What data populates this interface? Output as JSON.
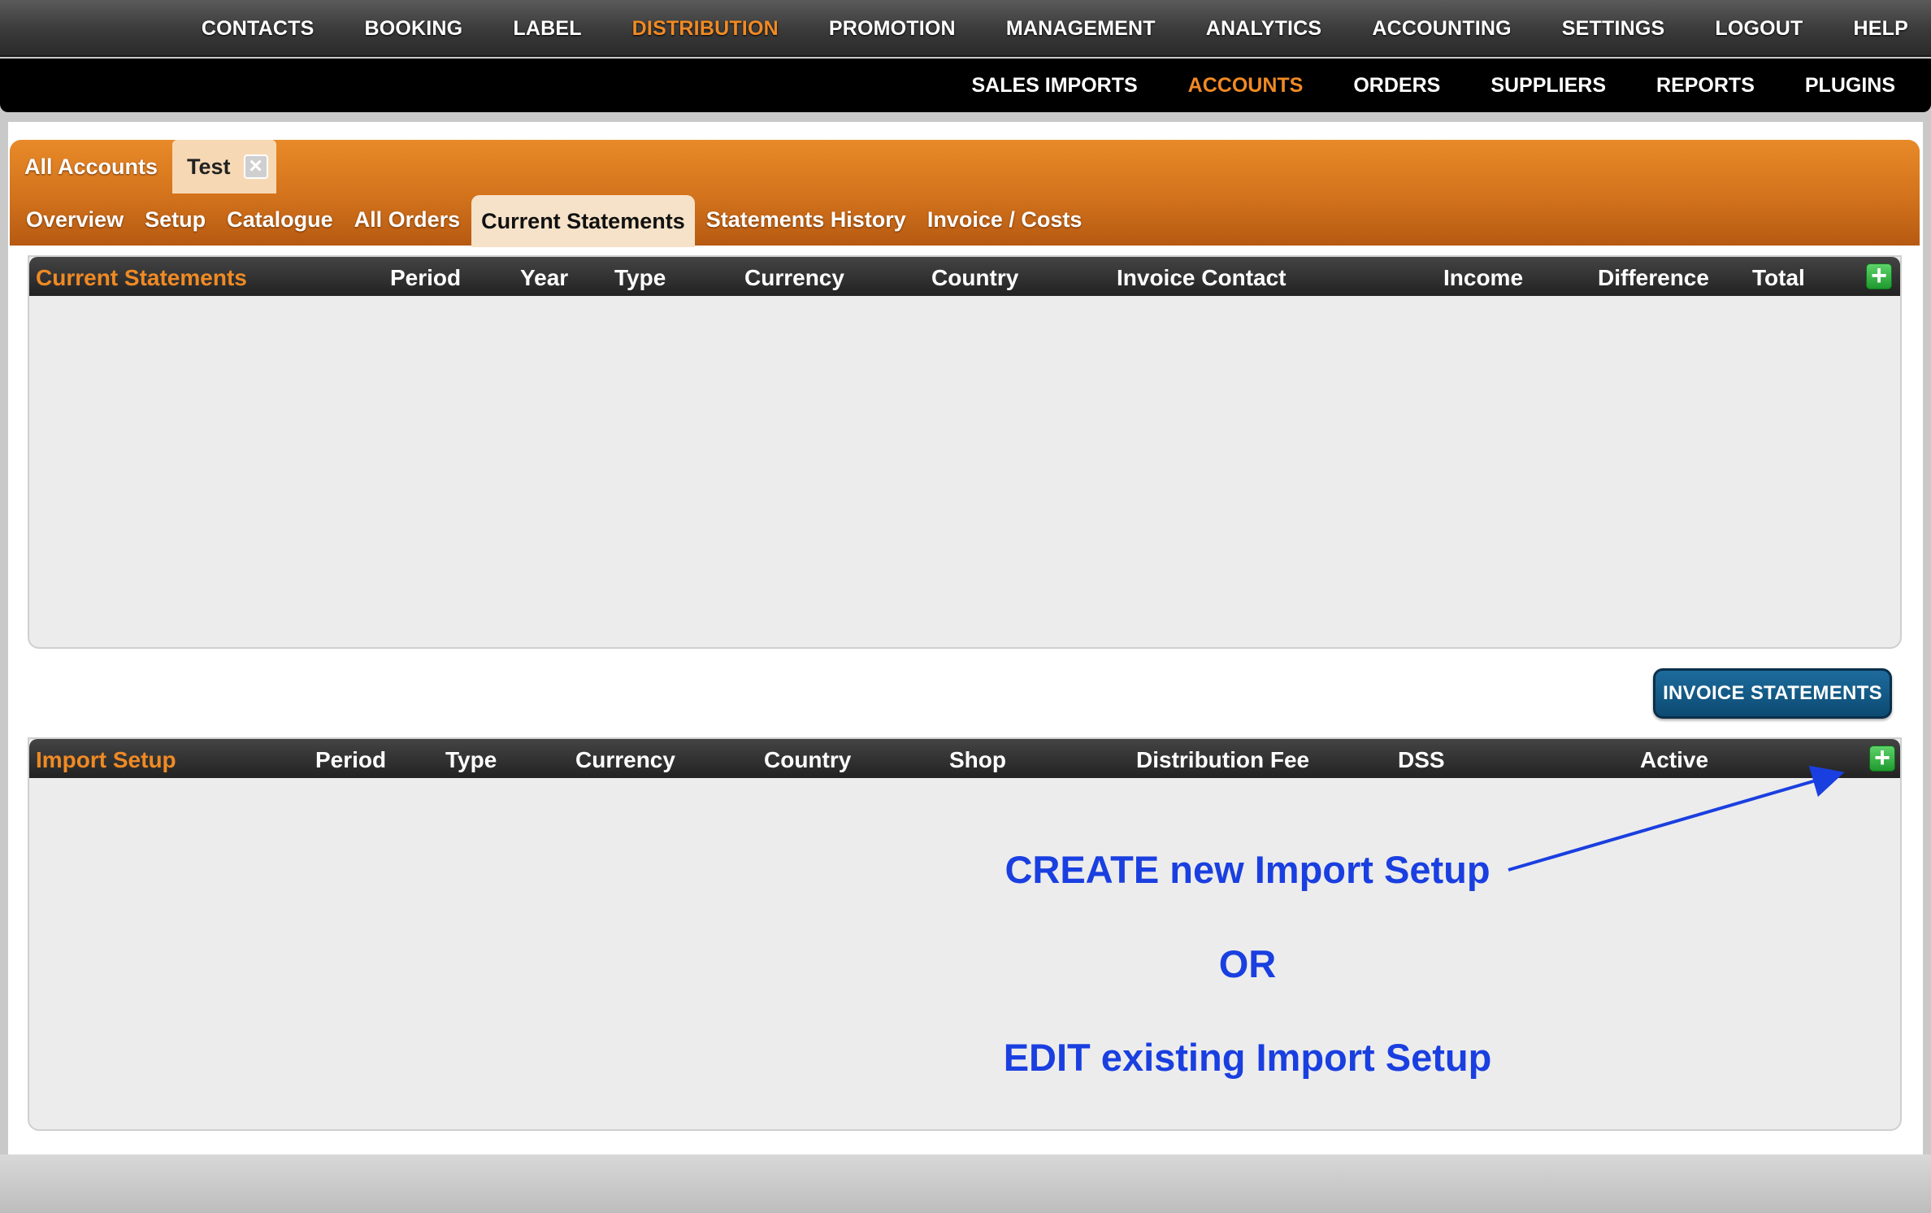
{
  "main_nav": {
    "items": [
      "CONTACTS",
      "BOOKING",
      "LABEL",
      "DISTRIBUTION",
      "PROMOTION",
      "MANAGEMENT",
      "ANALYTICS",
      "ACCOUNTING",
      "SETTINGS",
      "LOGOUT",
      "HELP"
    ],
    "active": "DISTRIBUTION"
  },
  "sub_nav": {
    "items": [
      "SALES IMPORTS",
      "ACCOUNTS",
      "ORDERS",
      "SUPPLIERS",
      "REPORTS",
      "PLUGINS"
    ],
    "active": "ACCOUNTS"
  },
  "account_tabs": {
    "all_label": "All Accounts",
    "open_label": "Test",
    "close_icon": "close-icon"
  },
  "section_tabs": {
    "items": [
      "Overview",
      "Setup",
      "Catalogue",
      "All Orders",
      "Current Statements",
      "Statements History",
      "Invoice / Costs"
    ],
    "active": "Current Statements"
  },
  "current_statements": {
    "title": "Current Statements",
    "columns": [
      "Period",
      "Year",
      "Type",
      "Currency",
      "Country",
      "Invoice Contact",
      "Income",
      "Difference",
      "Total"
    ],
    "rows": []
  },
  "invoice_button": "INVOICE STATEMENTS",
  "import_setup": {
    "title": "Import Setup",
    "columns": [
      "Period",
      "Type",
      "Currency",
      "Country",
      "Shop",
      "Distribution Fee",
      "DSS",
      "Active"
    ],
    "rows": []
  },
  "annotations": {
    "line1": "CREATE new Import Setup",
    "line2": "OR",
    "line3": "EDIT existing Import Setup",
    "color": "#1a3fe0"
  },
  "colors": {
    "accent": "#f08a24",
    "add_button": "#2fae3c",
    "invoice_button": "#0c4a72"
  }
}
